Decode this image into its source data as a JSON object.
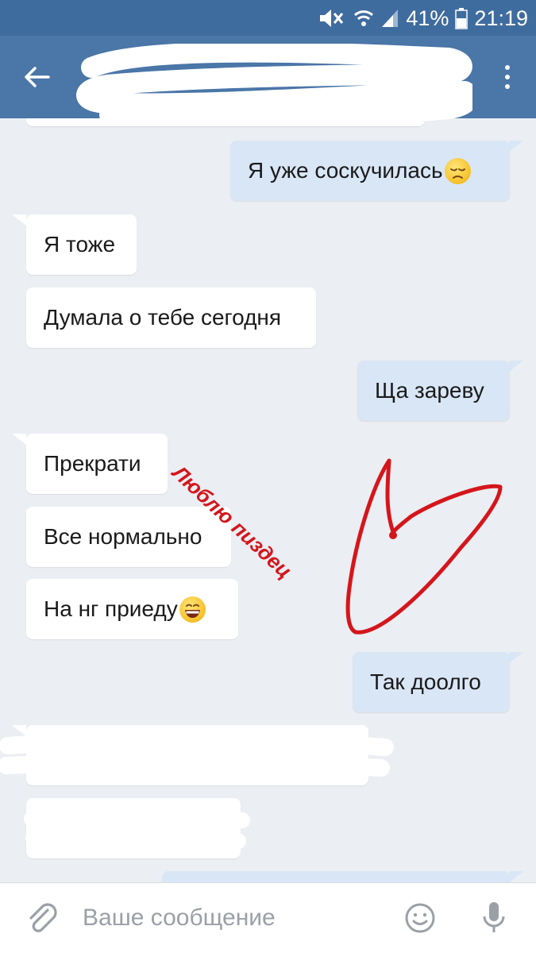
{
  "status_bar": {
    "battery_percent": "41%",
    "time": "21:19",
    "icons": [
      "mute-icon",
      "wifi-icon",
      "signal-icon",
      "battery-icon"
    ]
  },
  "header": {
    "back_icon": "arrow-left-icon",
    "menu_icon": "more-vertical-icon"
  },
  "messages": [
    {
      "direction": "out",
      "text": "Я уже соскучилась",
      "emoji": "pensive-face"
    },
    {
      "direction": "in",
      "text": "Я тоже"
    },
    {
      "direction": "in",
      "text": "Думала о тебе сегодня"
    },
    {
      "direction": "out",
      "text": "Ща зареву"
    },
    {
      "direction": "in",
      "text": "Прекрати"
    },
    {
      "direction": "in",
      "text": "Все нормально"
    },
    {
      "direction": "in",
      "text": "На нг приеду",
      "emoji": "grinning-face"
    },
    {
      "direction": "out",
      "text": "Так доолго"
    }
  ],
  "overlay": {
    "text": "Люблю пиздец",
    "color": "#d4161c"
  },
  "input": {
    "placeholder": "Ваше сообщение"
  },
  "colors": {
    "header": "#4a76a8",
    "status_bar": "#3f6c9e",
    "background": "#ebeef2",
    "incoming_bubble": "#ffffff",
    "outgoing_bubble": "#d9e6f6"
  }
}
